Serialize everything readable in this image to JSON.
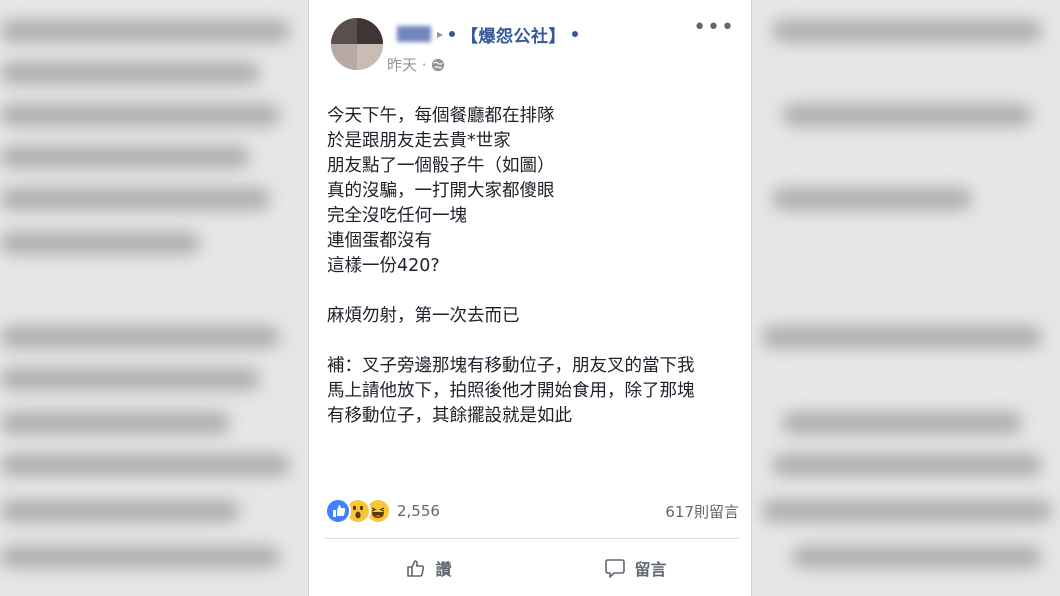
{
  "post": {
    "group_name": "【爆怨公社】",
    "timestamp": "昨天 ·",
    "content_lines": [
      "今天下午，每個餐廳都在排隊",
      "於是跟朋友走去貴*世家",
      "朋友點了一個骰子牛（如圖）",
      "真的沒騙，一打開大家都傻眼",
      "完全沒吃任何一塊",
      "連個蛋都沒有",
      "這樣一份420?",
      "",
      "麻煩勿射，第一次去而已",
      "",
      "補：叉子旁邊那塊有移動位子，朋友叉的當下我",
      "馬上請他放下，拍照後他才開始食用，除了那塊",
      "有移動位子，其餘擺設就是如此"
    ],
    "reaction_count": "2,556",
    "comment_count": "617則留言",
    "like_label": "讚",
    "comment_label": "留言",
    "more_label": "•••"
  },
  "colors": {
    "link_blue": "#365899",
    "meta_gray": "#90949c",
    "text": "#1d2129",
    "like_blue": "#4080ff",
    "emoji_yellow": "#f7c739"
  },
  "icons": [
    "avatar",
    "globe-icon",
    "more-icon",
    "like-reaction-icon",
    "wow-reaction-icon",
    "haha-reaction-icon",
    "thumbs-up-icon",
    "comment-bubble-icon"
  ]
}
